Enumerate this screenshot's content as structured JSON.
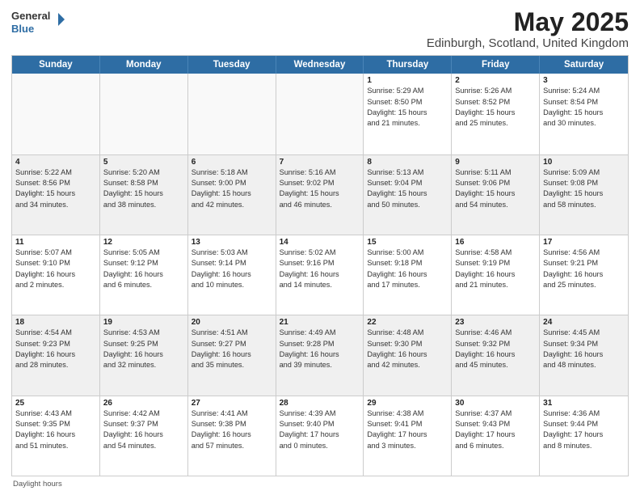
{
  "header": {
    "logo_general": "General",
    "logo_blue": "Blue",
    "month_title": "May 2025",
    "location": "Edinburgh, Scotland, United Kingdom"
  },
  "weekdays": [
    "Sunday",
    "Monday",
    "Tuesday",
    "Wednesday",
    "Thursday",
    "Friday",
    "Saturday"
  ],
  "footer": {
    "daylight_label": "Daylight hours"
  },
  "weeks": [
    [
      {
        "day": "",
        "info": ""
      },
      {
        "day": "",
        "info": ""
      },
      {
        "day": "",
        "info": ""
      },
      {
        "day": "",
        "info": ""
      },
      {
        "day": "1",
        "info": "Sunrise: 5:29 AM\nSunset: 8:50 PM\nDaylight: 15 hours\nand 21 minutes."
      },
      {
        "day": "2",
        "info": "Sunrise: 5:26 AM\nSunset: 8:52 PM\nDaylight: 15 hours\nand 25 minutes."
      },
      {
        "day": "3",
        "info": "Sunrise: 5:24 AM\nSunset: 8:54 PM\nDaylight: 15 hours\nand 30 minutes."
      }
    ],
    [
      {
        "day": "4",
        "info": "Sunrise: 5:22 AM\nSunset: 8:56 PM\nDaylight: 15 hours\nand 34 minutes."
      },
      {
        "day": "5",
        "info": "Sunrise: 5:20 AM\nSunset: 8:58 PM\nDaylight: 15 hours\nand 38 minutes."
      },
      {
        "day": "6",
        "info": "Sunrise: 5:18 AM\nSunset: 9:00 PM\nDaylight: 15 hours\nand 42 minutes."
      },
      {
        "day": "7",
        "info": "Sunrise: 5:16 AM\nSunset: 9:02 PM\nDaylight: 15 hours\nand 46 minutes."
      },
      {
        "day": "8",
        "info": "Sunrise: 5:13 AM\nSunset: 9:04 PM\nDaylight: 15 hours\nand 50 minutes."
      },
      {
        "day": "9",
        "info": "Sunrise: 5:11 AM\nSunset: 9:06 PM\nDaylight: 15 hours\nand 54 minutes."
      },
      {
        "day": "10",
        "info": "Sunrise: 5:09 AM\nSunset: 9:08 PM\nDaylight: 15 hours\nand 58 minutes."
      }
    ],
    [
      {
        "day": "11",
        "info": "Sunrise: 5:07 AM\nSunset: 9:10 PM\nDaylight: 16 hours\nand 2 minutes."
      },
      {
        "day": "12",
        "info": "Sunrise: 5:05 AM\nSunset: 9:12 PM\nDaylight: 16 hours\nand 6 minutes."
      },
      {
        "day": "13",
        "info": "Sunrise: 5:03 AM\nSunset: 9:14 PM\nDaylight: 16 hours\nand 10 minutes."
      },
      {
        "day": "14",
        "info": "Sunrise: 5:02 AM\nSunset: 9:16 PM\nDaylight: 16 hours\nand 14 minutes."
      },
      {
        "day": "15",
        "info": "Sunrise: 5:00 AM\nSunset: 9:18 PM\nDaylight: 16 hours\nand 17 minutes."
      },
      {
        "day": "16",
        "info": "Sunrise: 4:58 AM\nSunset: 9:19 PM\nDaylight: 16 hours\nand 21 minutes."
      },
      {
        "day": "17",
        "info": "Sunrise: 4:56 AM\nSunset: 9:21 PM\nDaylight: 16 hours\nand 25 minutes."
      }
    ],
    [
      {
        "day": "18",
        "info": "Sunrise: 4:54 AM\nSunset: 9:23 PM\nDaylight: 16 hours\nand 28 minutes."
      },
      {
        "day": "19",
        "info": "Sunrise: 4:53 AM\nSunset: 9:25 PM\nDaylight: 16 hours\nand 32 minutes."
      },
      {
        "day": "20",
        "info": "Sunrise: 4:51 AM\nSunset: 9:27 PM\nDaylight: 16 hours\nand 35 minutes."
      },
      {
        "day": "21",
        "info": "Sunrise: 4:49 AM\nSunset: 9:28 PM\nDaylight: 16 hours\nand 39 minutes."
      },
      {
        "day": "22",
        "info": "Sunrise: 4:48 AM\nSunset: 9:30 PM\nDaylight: 16 hours\nand 42 minutes."
      },
      {
        "day": "23",
        "info": "Sunrise: 4:46 AM\nSunset: 9:32 PM\nDaylight: 16 hours\nand 45 minutes."
      },
      {
        "day": "24",
        "info": "Sunrise: 4:45 AM\nSunset: 9:34 PM\nDaylight: 16 hours\nand 48 minutes."
      }
    ],
    [
      {
        "day": "25",
        "info": "Sunrise: 4:43 AM\nSunset: 9:35 PM\nDaylight: 16 hours\nand 51 minutes."
      },
      {
        "day": "26",
        "info": "Sunrise: 4:42 AM\nSunset: 9:37 PM\nDaylight: 16 hours\nand 54 minutes."
      },
      {
        "day": "27",
        "info": "Sunrise: 4:41 AM\nSunset: 9:38 PM\nDaylight: 16 hours\nand 57 minutes."
      },
      {
        "day": "28",
        "info": "Sunrise: 4:39 AM\nSunset: 9:40 PM\nDaylight: 17 hours\nand 0 minutes."
      },
      {
        "day": "29",
        "info": "Sunrise: 4:38 AM\nSunset: 9:41 PM\nDaylight: 17 hours\nand 3 minutes."
      },
      {
        "day": "30",
        "info": "Sunrise: 4:37 AM\nSunset: 9:43 PM\nDaylight: 17 hours\nand 6 minutes."
      },
      {
        "day": "31",
        "info": "Sunrise: 4:36 AM\nSunset: 9:44 PM\nDaylight: 17 hours\nand 8 minutes."
      }
    ]
  ]
}
